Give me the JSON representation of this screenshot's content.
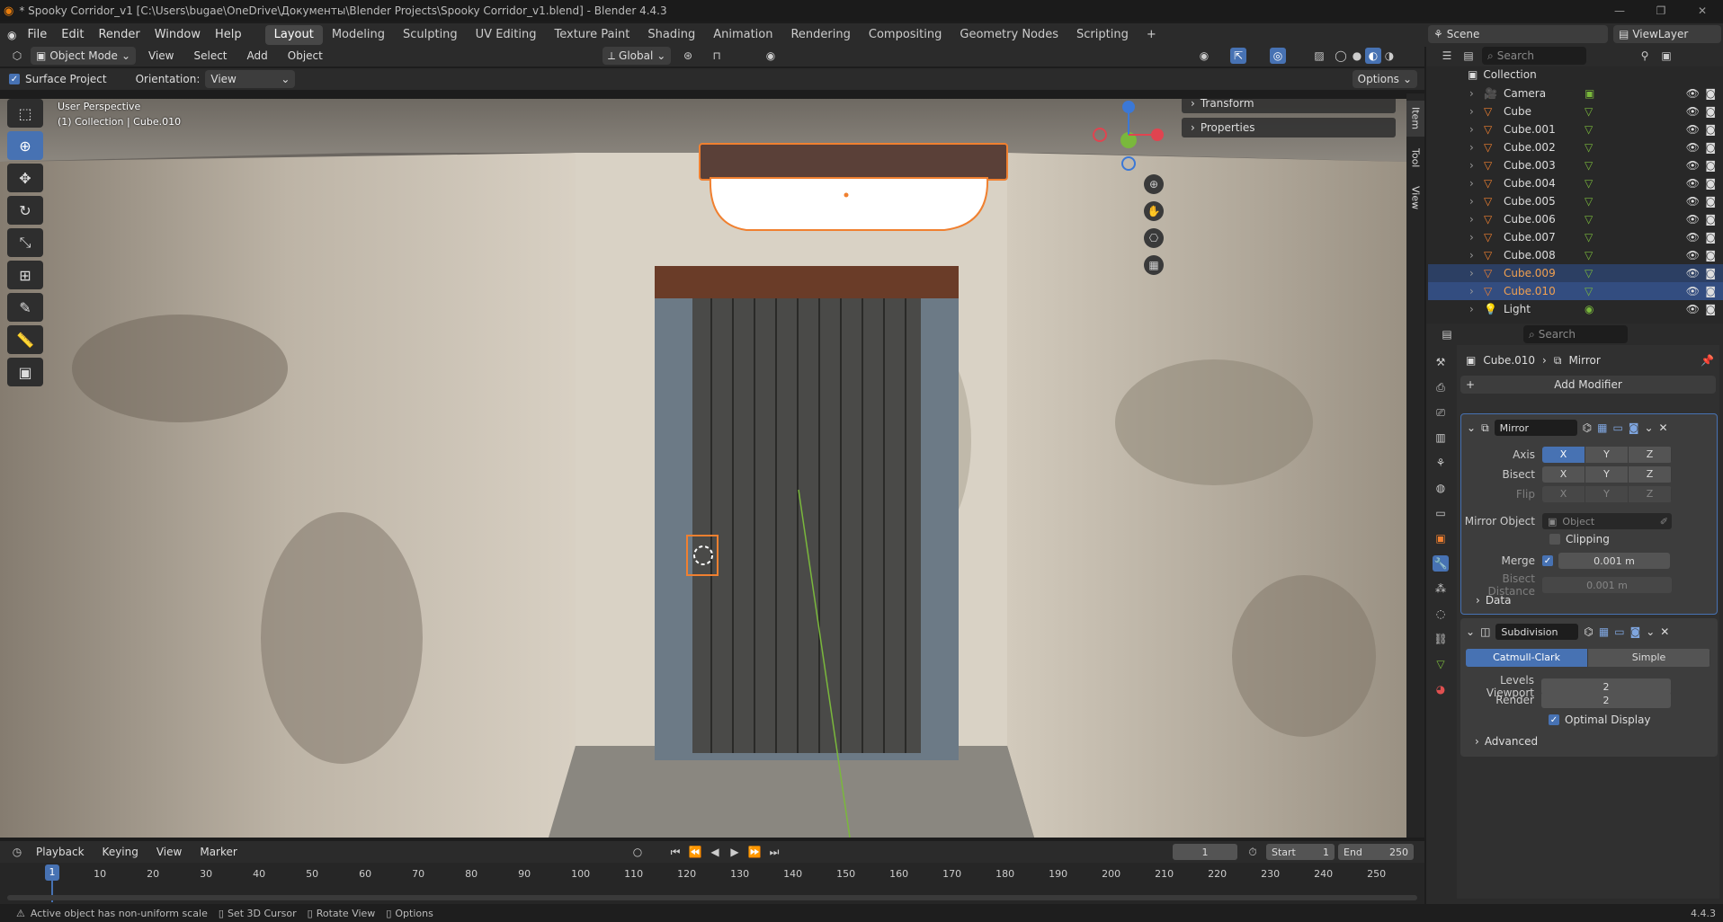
{
  "window": {
    "title": "* Spooky Corridor_v1 [C:\\Users\\bugae\\OneDrive\\Документы\\Blender Projects\\Spooky Corridor_v1.blend] - Blender 4.4.3"
  },
  "menu": [
    "File",
    "Edit",
    "Render",
    "Window",
    "Help"
  ],
  "workspaces": [
    "Layout",
    "Modeling",
    "Sculpting",
    "UV Editing",
    "Texture Paint",
    "Shading",
    "Animation",
    "Rendering",
    "Compositing",
    "Geometry Nodes",
    "Scripting"
  ],
  "workspace_active": "Layout",
  "scene": {
    "name": "Scene",
    "view_layer": "ViewLayer"
  },
  "viewport_header": {
    "mode": "Object Mode",
    "menus": [
      "View",
      "Select",
      "Add",
      "Object"
    ],
    "transform_orientation": "Global"
  },
  "tool_settings": {
    "surface_project": "Surface Project",
    "orientation_label": "Orientation:",
    "orientation_value": "View",
    "options": "Options"
  },
  "viewport": {
    "perspective": "User Perspective",
    "collection_info": "(1) Collection | Cube.010",
    "sidebar_panels": [
      "Transform",
      "Properties"
    ],
    "sidebar_tabs": [
      "Item",
      "Tool",
      "View"
    ]
  },
  "outliner": {
    "search_placeholder": "Search",
    "collection": "Collection",
    "items": [
      {
        "name": "Camera",
        "type": "camera"
      },
      {
        "name": "Cube",
        "type": "mesh"
      },
      {
        "name": "Cube.001",
        "type": "mesh"
      },
      {
        "name": "Cube.002",
        "type": "mesh"
      },
      {
        "name": "Cube.003",
        "type": "mesh"
      },
      {
        "name": "Cube.004",
        "type": "mesh"
      },
      {
        "name": "Cube.005",
        "type": "mesh"
      },
      {
        "name": "Cube.006",
        "type": "mesh"
      },
      {
        "name": "Cube.007",
        "type": "mesh"
      },
      {
        "name": "Cube.008",
        "type": "mesh"
      },
      {
        "name": "Cube.009",
        "type": "mesh",
        "selected": true
      },
      {
        "name": "Cube.010",
        "type": "mesh",
        "active": true
      },
      {
        "name": "Light",
        "type": "light"
      }
    ]
  },
  "properties": {
    "search_placeholder": "Search",
    "breadcrumb_object": "Cube.010",
    "breadcrumb_modifier": "Mirror",
    "add_modifier": "Add Modifier",
    "mirror": {
      "name": "Mirror",
      "axis_label": "Axis",
      "bisect_label": "Bisect",
      "flip_label": "Flip",
      "axes": [
        "X",
        "Y",
        "Z"
      ],
      "mirror_object_label": "Mirror Object",
      "mirror_object_placeholder": "Object",
      "clipping_label": "Clipping",
      "merge_label": "Merge",
      "merge_value": "0.001 m",
      "bisect_distance_label": "Bisect Distance",
      "bisect_distance_value": "0.001 m",
      "data_label": "Data"
    },
    "subdivision": {
      "name": "Subdivision",
      "catmull": "Catmull-Clark",
      "simple": "Simple",
      "levels_viewport_label": "Levels Viewport",
      "levels_viewport_value": "2",
      "render_label": "Render",
      "render_value": "2",
      "optimal_display_label": "Optimal Display",
      "advanced_label": "Advanced"
    }
  },
  "timeline": {
    "menus": [
      "Playback",
      "Keying",
      "View",
      "Marker"
    ],
    "current_frame": "1",
    "start_label": "Start",
    "start_value": "1",
    "end_label": "End",
    "end_value": "250",
    "ticks": [
      "1",
      "10",
      "20",
      "30",
      "40",
      "50",
      "60",
      "70",
      "80",
      "90",
      "100",
      "110",
      "120",
      "130",
      "140",
      "150",
      "160",
      "170",
      "180",
      "190",
      "200",
      "210",
      "220",
      "230",
      "240",
      "250"
    ]
  },
  "statusbar": {
    "warning": "Active object has non-uniform scale",
    "hint1": "Set 3D Cursor",
    "hint2": "Rotate View",
    "hint3": "Options",
    "version": "4.4.3"
  },
  "colors": {
    "accent": "#4772b3",
    "selection_orange": "#f08030",
    "selected_row": "#334d80"
  }
}
